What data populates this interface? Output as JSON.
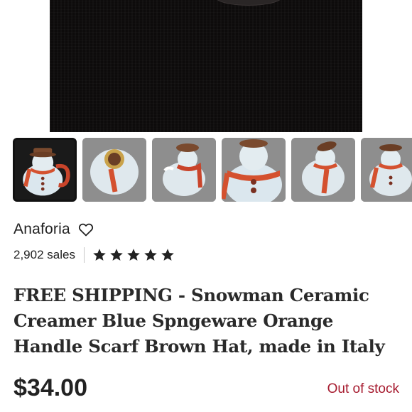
{
  "product": {
    "images": [
      {
        "icon": "snowman-creamer-front"
      },
      {
        "icon": "snowman-creamer-top"
      },
      {
        "icon": "snowman-creamer-back"
      },
      {
        "icon": "snowman-creamer-closeup"
      },
      {
        "icon": "snowman-creamer-side"
      },
      {
        "icon": "snowman-creamer-angle"
      }
    ],
    "title": "FREE SHIPPING - Snowman Ceramic Creamer Blue Spngeware Orange Handle Scarf Brown Hat, made in Italy",
    "price": "$34.00",
    "stock_status": "Out of stock"
  },
  "shop": {
    "name": "Anaforia",
    "sales": "2,902 sales",
    "rating": 5,
    "rating_max": 5
  },
  "colors": {
    "out_of_stock": "#a61a2e",
    "star": "#222222",
    "hero_background": "#0d0b0b"
  }
}
